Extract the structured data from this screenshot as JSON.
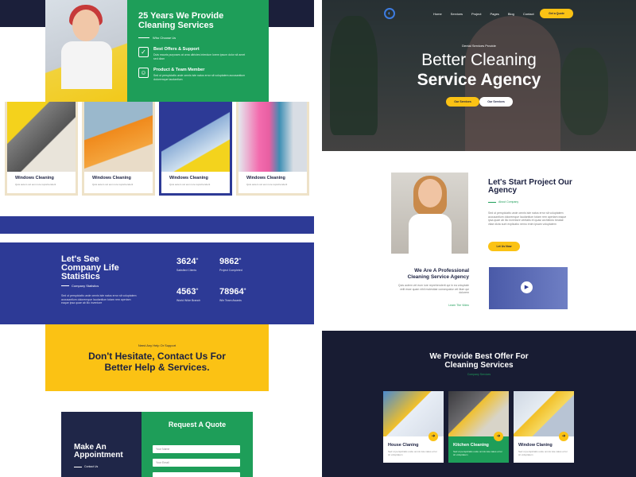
{
  "left": {
    "about": {
      "title": "25 Years We Provide Cleaning Services",
      "subtitle": "Who Choose Us",
      "items": [
        {
          "icon": "check-icon",
          "title": "Best Offers & Support",
          "text": "Duis mauris purposes at urna ultricies interdum lorem ipsum dolor sit amet sed diam"
        },
        {
          "icon": "team-icon",
          "title": "Product & Team Member",
          "text": "Sed ut perspiciatis unde omnis iste natus error sit voluptatem accusantium doloremque laudantium"
        }
      ]
    },
    "cards": [
      {
        "title": "Windows Cleaning",
        "text": "Quis autem vel eum iure reprehenderit"
      },
      {
        "title": "Windows Cleaning",
        "text": "Quis autem vel eum iure reprehenderit"
      },
      {
        "title": "Windows Cleaning",
        "text": "Quis autem vel eum iure reprehenderit"
      },
      {
        "title": "Windows Cleaning",
        "text": "Quis autem vel eum iure reprehenderit"
      }
    ],
    "stats": {
      "title": "Let's See Company Life Statistics",
      "subtitle": "Company Statistics",
      "text": "Sed ut perspiciatis unde omnis iste natus error sit voluptatem accusantium doloremque laudantium totam rem aperiam eaque ipsa quae ab illo inventore",
      "items": [
        {
          "value": "3624",
          "label": "Satisfied Clients"
        },
        {
          "value": "9862",
          "label": "Project Completed"
        },
        {
          "value": "4563",
          "label": "World Wide Branch"
        },
        {
          "value": "78964",
          "label": "Win Team Awards"
        }
      ]
    },
    "cta": {
      "small": "Need Any Help Or Support",
      "title": "Don't Hesitate, Contact Us For Better Help & Services."
    },
    "appointment": {
      "title": "Make An Appointment",
      "subtitle": "Contact Us"
    },
    "quote": {
      "title": "Request A Quote",
      "fields": [
        "Your Name",
        "Your Email"
      ]
    }
  },
  "right": {
    "nav": {
      "items": [
        "Home",
        "Services",
        "Project",
        "Pages",
        "Blog",
        "Contact"
      ],
      "button": "Get a Quote"
    },
    "hero": {
      "small": "Dental Services Provide",
      "line1": "Better Cleaning",
      "line2": "Service Agency",
      "btn1": "Our Services",
      "btn2": "Our Services"
    },
    "about": {
      "title": "Let's Start Project Our Agency",
      "subtitle": "About Company",
      "text": "Sed ut perspiciatis unde omnis iste natus error sit voluptatem accusantium doloremque laudantium totam rem aperiam eaque ipsa quae ab illo inventore veritatis et quasi architecto beatae vitae dicta sunt explicabo nemo enim ipsam voluptatem",
      "button": "Let Us Now"
    },
    "professional": {
      "title": "We Are A Professional Cleaning Service Agency",
      "text": "Quis autem vel eum iure reprehenderit qui in ea voluptate velit esse quam nihil molestiae consequatur vel illum qui dolorem",
      "link": "Learn The Video"
    },
    "offer": {
      "title": "We Provide Best Offer For Cleaning Services",
      "subtitle": "Company Services",
      "services": [
        {
          "title": "House Claning",
          "text": "Sed ut perspiciatis unde omnis iste natus error sit voluptatem"
        },
        {
          "title": "Kitchen Cleaning",
          "text": "Sed ut perspiciatis unde omnis iste natus error sit voluptatem"
        },
        {
          "title": "Window Claning",
          "text": "Sed ut perspiciatis unde omnis iste natus error sit voluptatem"
        }
      ]
    }
  },
  "colors": {
    "green": "#1e9e59",
    "navy": "#1b1f3a",
    "blue": "#2d3a96",
    "yellow": "#fbc214"
  }
}
